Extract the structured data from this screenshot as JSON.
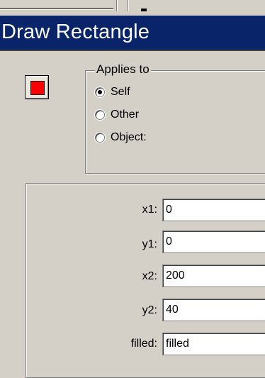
{
  "window": {
    "title": "Draw Rectangle"
  },
  "color_swatch": {
    "icon": "red-color-swatch-icon",
    "color": "#ff0000"
  },
  "applies_to": {
    "label": "Applies to",
    "options": [
      {
        "label": "Self",
        "checked": true
      },
      {
        "label": "Other",
        "checked": false
      },
      {
        "label": "Object:",
        "checked": false
      }
    ]
  },
  "fields": [
    {
      "label": "x1:",
      "value": "0"
    },
    {
      "label": "y1:",
      "value": "0"
    },
    {
      "label": "x2:",
      "value": "200"
    },
    {
      "label": "y2:",
      "value": "40"
    },
    {
      "label": "filled:",
      "value": "filled"
    }
  ],
  "colors": {
    "title_bar": "#0a246a",
    "dialog_background": "#d4d0c8"
  }
}
